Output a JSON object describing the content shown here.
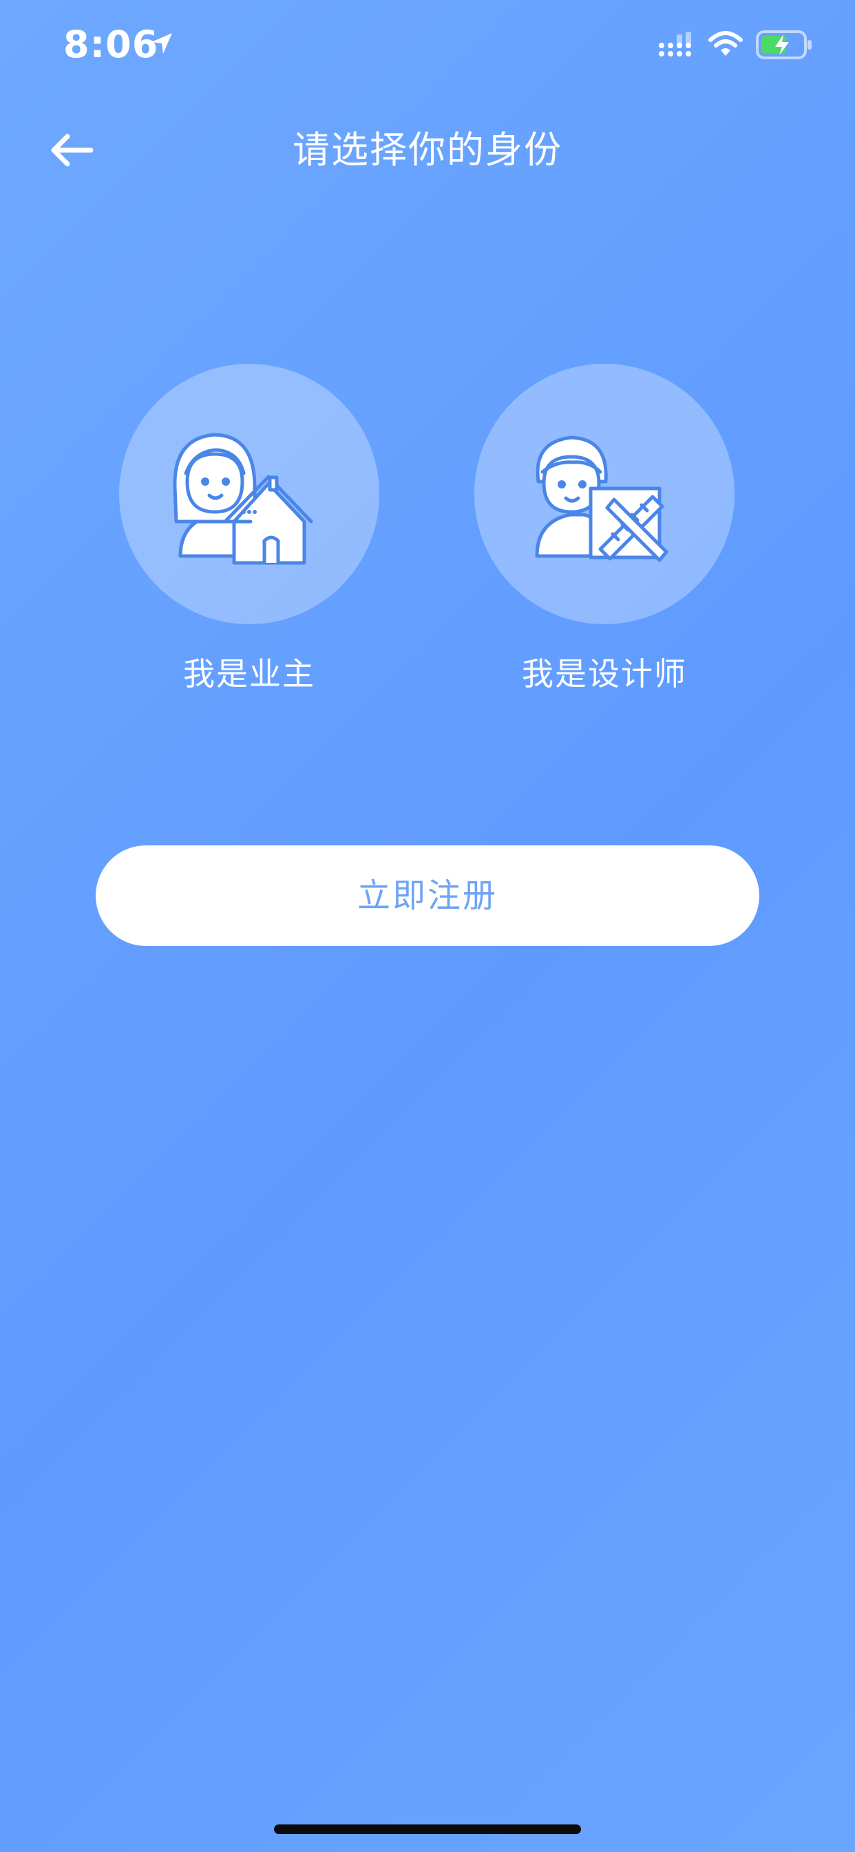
{
  "status_bar": {
    "time": "8:06",
    "icons": [
      "location-arrow-icon",
      "cellular-signal-icon",
      "wifi-icon",
      "battery-charging-icon"
    ]
  },
  "nav": {
    "back_icon": "back-arrow-icon",
    "title": "请选择你的身份"
  },
  "roles": [
    {
      "label": "我是业主",
      "icon": "homeowner-house-icon"
    },
    {
      "label": "我是设计师",
      "icon": "designer-ruler-icon"
    }
  ],
  "register": {
    "label": "立即注册"
  },
  "colors": {
    "background_gradient_start": "#6ea8ff",
    "background_gradient_end": "#5f9bff",
    "button_text": "#6ea4f5",
    "icon_stroke": "#4a86e8",
    "battery_fill": "#4cd964"
  }
}
